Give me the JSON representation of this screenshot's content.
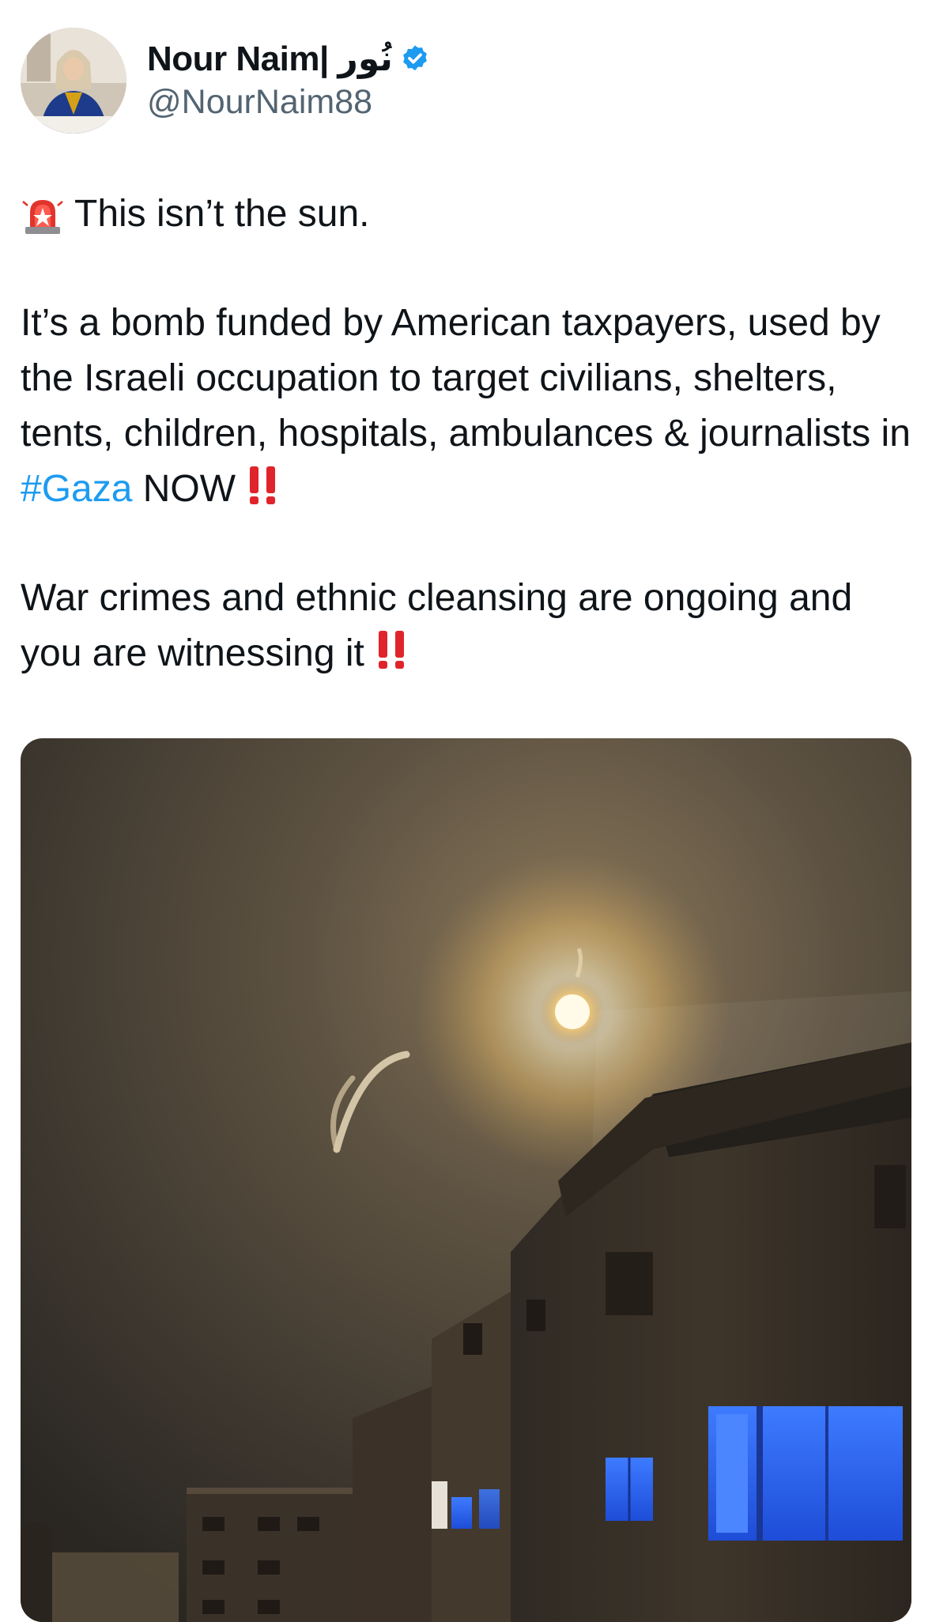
{
  "author": {
    "display_name": "Nour Naim| نُور",
    "handle": "@NourNaim88",
    "verified": true,
    "verified_color": "#1d9bf0",
    "avatar_icon": "profile-photo-icon"
  },
  "tweet": {
    "line1": "This isn’t the sun.",
    "para2_before_tag": "It’s a bomb funded by American taxpayers, used by the Israeli occupation to target civilians, shelters, tents, children, hospitals, ambulances & journalists in ",
    "hashtag": "#Gaza",
    "para2_after_tag": " NOW",
    "para3": "War crimes and ethnic cleansing are ongoing and you are witnessing it",
    "emoji_siren": "police-car-light-icon",
    "emoji_bang": "double-exclamation-icon",
    "hashtag_color": "#1d9bf0"
  },
  "media": {
    "icon": "night-sky-flare-photo"
  }
}
